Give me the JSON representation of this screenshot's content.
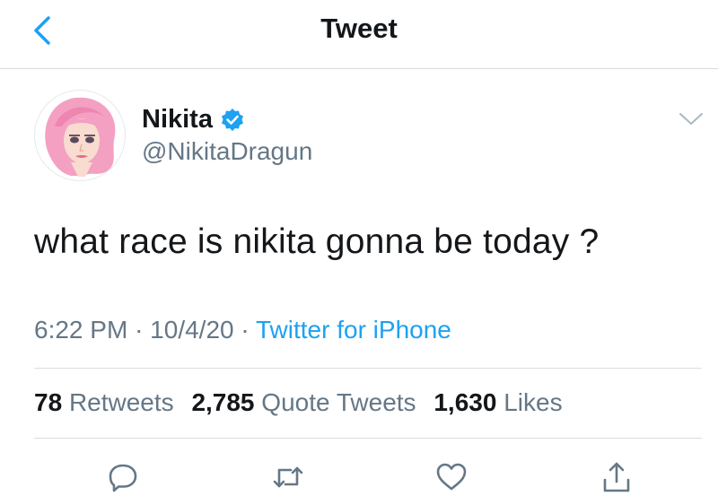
{
  "header": {
    "title": "Tweet",
    "back_icon": "chevron-left-icon"
  },
  "author": {
    "display_name": "Nikita",
    "handle": "@NikitaDragun",
    "verified": true
  },
  "tweet": {
    "text": "what race is nikita gonna be today ?"
  },
  "meta": {
    "time": "6:22 PM",
    "separator": "·",
    "date": "10/4/20",
    "source": "Twitter for iPhone"
  },
  "stats": {
    "retweets_count": "78",
    "retweets_label": "Retweets",
    "quotes_count": "2,785",
    "quotes_label": "Quote Tweets",
    "likes_count": "1,630",
    "likes_label": "Likes"
  },
  "actions": [
    "reply-icon",
    "retweet-icon",
    "like-icon",
    "share-icon"
  ],
  "colors": {
    "accent": "#1da1f2",
    "secondary_text": "#657786",
    "primary_text": "#14171a",
    "divider": "#d8dde1"
  }
}
